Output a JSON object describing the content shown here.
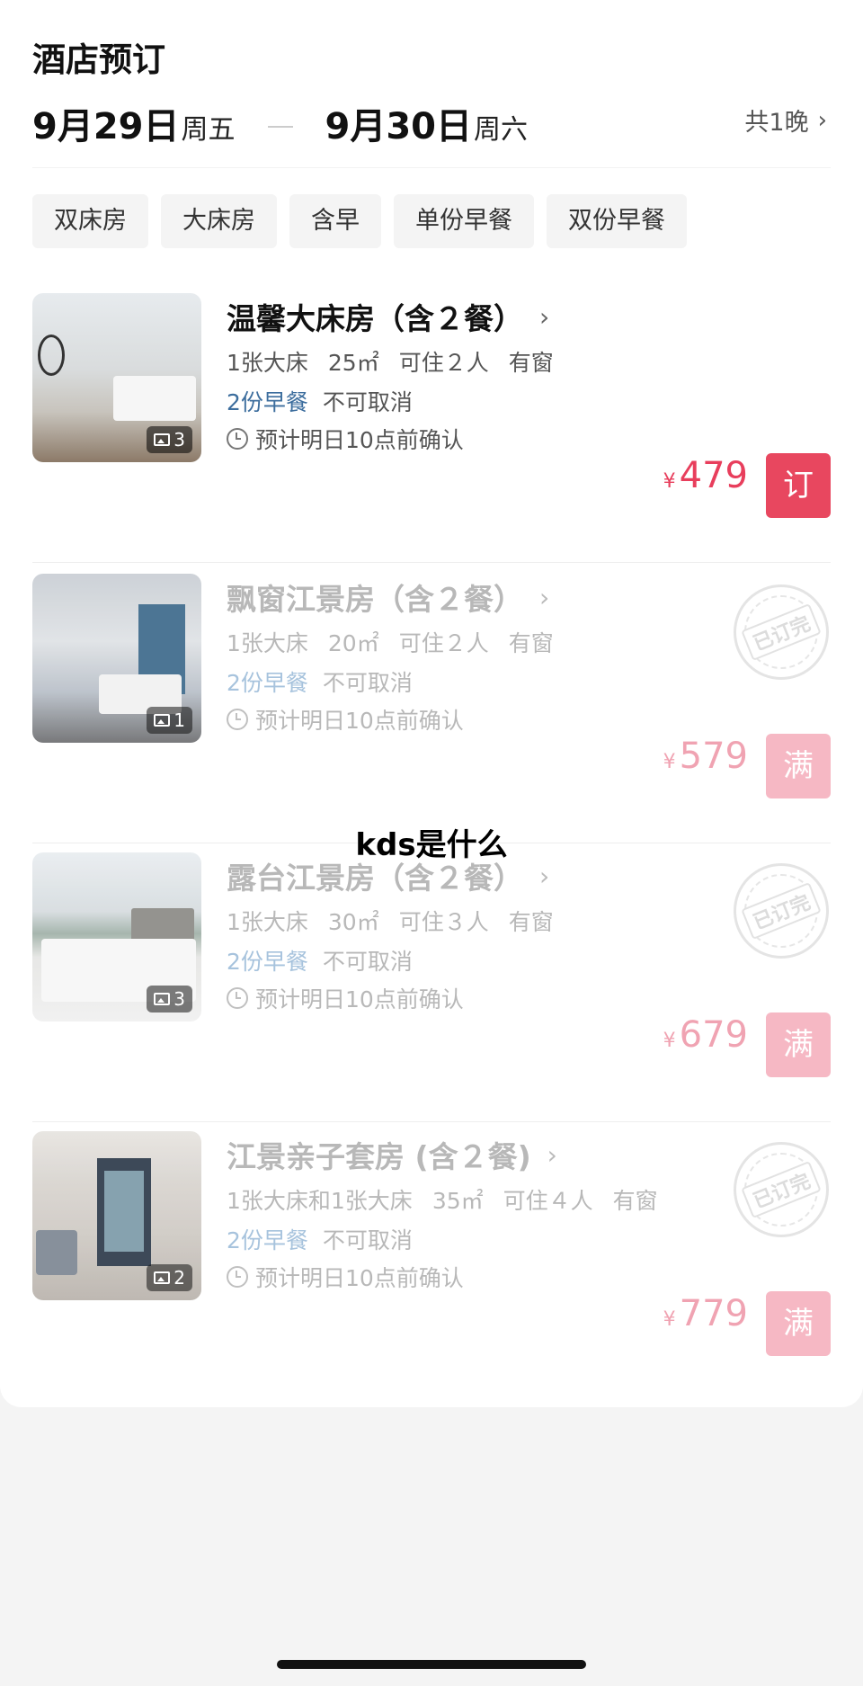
{
  "header": {
    "title": "酒店预订",
    "checkin_date": "9月29日",
    "checkin_day": "周五",
    "checkout_date": "9月30日",
    "checkout_day": "周六",
    "nights": "共1晚"
  },
  "filters": [
    "双床房",
    "大床房",
    "含早",
    "单份早餐",
    "双份早餐"
  ],
  "rooms": [
    {
      "name": "温馨大床房（含２餐）",
      "bed": "1张大床",
      "area": "25㎡",
      "occupancy": "可住２人",
      "window": "有窗",
      "meal": "2份早餐",
      "cancel": "不可取消",
      "confirm": "预计明日10点前确认",
      "currency": "¥",
      "price": "479",
      "button": "订",
      "photo_count": "3"
    },
    {
      "name": "飘窗江景房（含２餐）",
      "bed": "1张大床",
      "area": "20㎡",
      "occupancy": "可住２人",
      "window": "有窗",
      "meal": "2份早餐",
      "cancel": "不可取消",
      "confirm": "预计明日10点前确认",
      "currency": "¥",
      "price": "579",
      "button": "满",
      "photo_count": "1",
      "stamp": "已订完"
    },
    {
      "name": "露台江景房（含２餐）",
      "bed": "1张大床",
      "area": "30㎡",
      "occupancy": "可住３人",
      "window": "有窗",
      "meal": "2份早餐",
      "cancel": "不可取消",
      "confirm": "预计明日10点前确认",
      "currency": "¥",
      "price": "679",
      "button": "满",
      "photo_count": "3",
      "stamp": "已订完"
    },
    {
      "name": "江景亲子套房 (含２餐)",
      "bed": "1张大床和1张大床",
      "area": "35㎡",
      "occupancy": "可住４人",
      "window": "有窗",
      "meal": "2份早餐",
      "cancel": "不可取消",
      "confirm": "预计明日10点前确认",
      "currency": "¥",
      "price": "779",
      "button": "满",
      "photo_count": "2",
      "stamp": "已订完"
    }
  ],
  "overlay_text": "kds是什么",
  "colors": {
    "accent": "#e8475f",
    "accent_faded": "#f6b8c4",
    "meal_blue": "#3d6e9e"
  }
}
